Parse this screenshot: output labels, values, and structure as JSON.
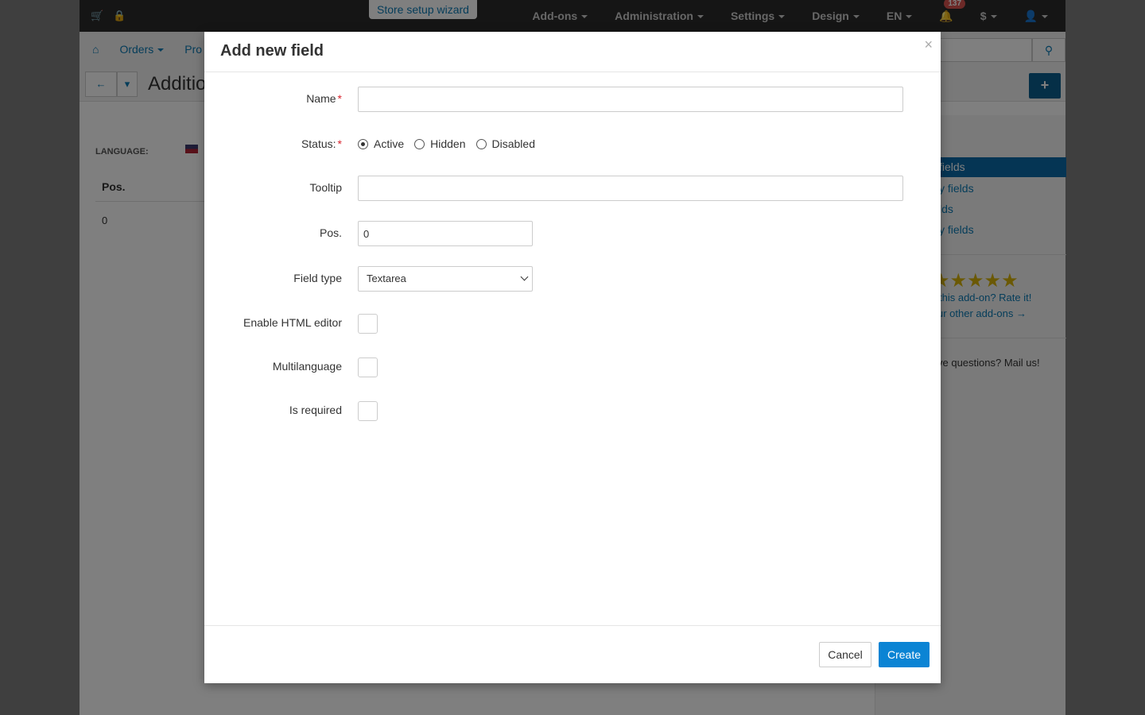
{
  "topbar": {
    "wizard_label": "Store setup wizard",
    "menu": [
      "Add-ons",
      "Administration",
      "Settings",
      "Design",
      "EN"
    ],
    "notifications_count": "137",
    "currency": "$"
  },
  "subnav": {
    "orders": "Orders",
    "products_partial": "Pro",
    "page_title_partial": "Additio"
  },
  "content": {
    "language_label": "LANGUAGE:",
    "column_pos": "Pos.",
    "row_pos_value": "0"
  },
  "sidebar": {
    "active_item": "fields",
    "items": [
      "y fields",
      "lds",
      "y fields"
    ],
    "rate_text": "this add-on? Rate it!",
    "other_addons": "ur other add-ons →",
    "mail_text": "ve questions? Mail us!",
    "rating_stars": 5
  },
  "modal": {
    "title": "Add new field",
    "close_symbol": "×",
    "fields": {
      "name": {
        "label": "Name",
        "value": ""
      },
      "status": {
        "label": "Status:",
        "options": [
          "Active",
          "Hidden",
          "Disabled"
        ],
        "selected": "Active"
      },
      "tooltip": {
        "label": "Tooltip",
        "value": ""
      },
      "pos": {
        "label": "Pos.",
        "value": "0"
      },
      "field_type": {
        "label": "Field type",
        "selected": "Textarea"
      },
      "html_editor": {
        "label": "Enable HTML editor",
        "checked": false
      },
      "multilanguage": {
        "label": "Multilanguage",
        "checked": false
      },
      "is_required": {
        "label": "Is required",
        "checked": false
      }
    },
    "required_marker": "*",
    "cancel_label": "Cancel",
    "create_label": "Create"
  },
  "colors": {
    "primary": "#0b84d4",
    "topbar": "#2b2b2b",
    "required": "#d9232d",
    "sidebar_active": "#0b6aa8"
  }
}
